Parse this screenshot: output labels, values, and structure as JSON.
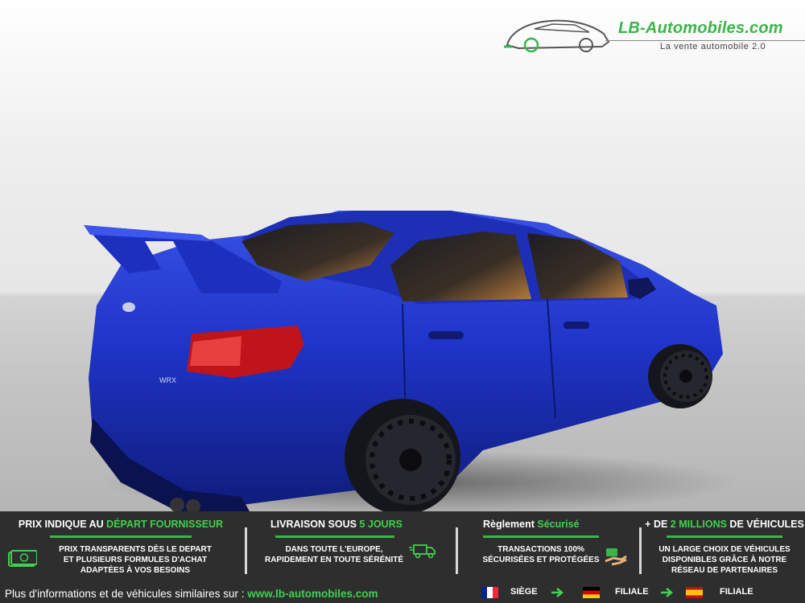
{
  "logo": {
    "brand": "LB-Automobiles.com",
    "tagline": "La vente automobile 2.0"
  },
  "photo": {
    "badge": "WRX",
    "body_color": "#1f34c8"
  },
  "features": [
    {
      "title_prefix": "PRIX INDIQUE AU ",
      "title_highlight": "DÉPART FOURNISSEUR",
      "title_suffix": "",
      "lines": [
        "PRIX TRANSPARENTS DÈS LE DEPART",
        "ET PLUSIEURS FORMULES D'ACHAT",
        "ADAPTÉES À VOS BESOINS"
      ],
      "icon": "cash-icon"
    },
    {
      "title_prefix": "LIVRAISON SOUS ",
      "title_highlight": "5 JOURS",
      "title_suffix": "",
      "lines": [
        "DANS TOUTE L'EUROPE,",
        "RAPIDEMENT EN TOUTE SÉRÉNITÉ"
      ],
      "icon": "delivery-truck-icon"
    },
    {
      "title_prefix": "Règlement ",
      "title_highlight": "Sécurisé",
      "title_suffix": "",
      "lines": [
        "TRANSACTIONS 100%",
        "SÉCURISÉES ET PROTÉGÉES"
      ],
      "icon": "secure-payment-icon"
    },
    {
      "title_prefix": "+ DE ",
      "title_highlight": "2 MILLIONS",
      "title_suffix": " DE VÉHICULES",
      "lines": [
        "UN LARGE CHOIX DE VÉHICULES",
        "DISPONIBLES GRÂCE À NOTRE",
        "RÉSEAU DE PARTENAIRES"
      ],
      "icon": ""
    }
  ],
  "footer": {
    "text": "Plus d'informations et de véhicules similaires sur : ",
    "link": "www.lb-automobiles.com",
    "locations": [
      {
        "flag": "france-flag-icon",
        "label": "SIÈGE"
      },
      {
        "flag": "germany-flag-icon",
        "label": "FILIALE"
      },
      {
        "flag": "spain-flag-icon",
        "label": "FILIALE"
      }
    ]
  },
  "colors": {
    "accent": "#3ab54a",
    "banner": "#2e2e2e"
  }
}
